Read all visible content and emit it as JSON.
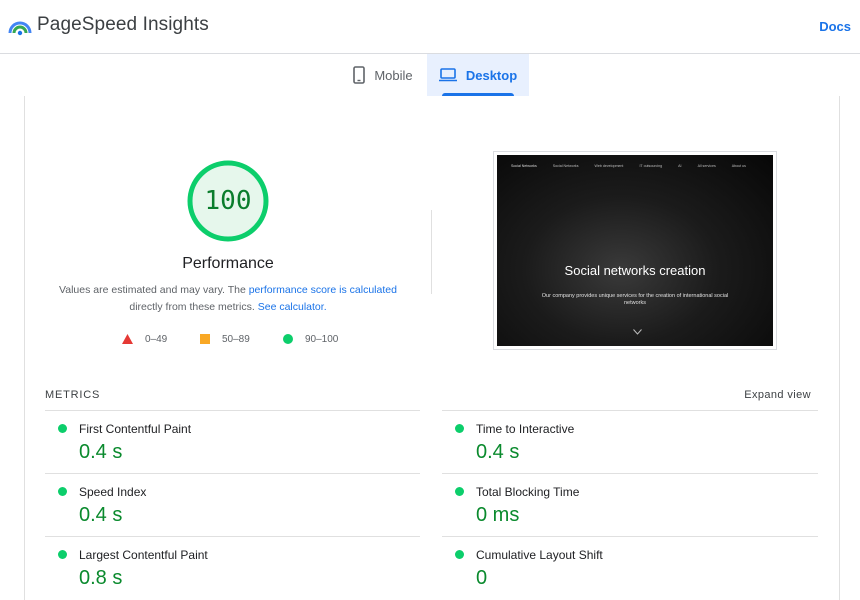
{
  "header": {
    "title": "PageSpeed Insights",
    "docs_label": "Docs"
  },
  "tabs": [
    {
      "label": "Mobile",
      "icon": "smartphone-icon",
      "active": false
    },
    {
      "label": "Desktop",
      "icon": "laptop-icon",
      "active": true
    }
  ],
  "performance": {
    "score": "100",
    "score_fraction": 1.0,
    "title": "Performance",
    "desc_prefix": "Values are estimated and may vary. The ",
    "desc_link1": "performance score is calculated",
    "desc_middle": "directly from these metrics. ",
    "desc_link2": "See calculator."
  },
  "legend": [
    {
      "shape": "triangle",
      "range": "0–49",
      "color": "#e53935"
    },
    {
      "shape": "square",
      "range": "50–89",
      "color": "#f9a825"
    },
    {
      "shape": "circle",
      "range": "90–100",
      "color": "#0cce6b"
    }
  ],
  "screenshot": {
    "nav_brand": "Social Networks",
    "nav_items": [
      "Social Networks",
      "Web development",
      "IT outsourcing",
      "AI",
      "All services",
      "About us"
    ],
    "headline": "Social networks creation",
    "subtext": "Our company provides unique services for the creation of international social networks"
  },
  "metrics_section": {
    "label": "METRICS",
    "expand_label": "Expand view"
  },
  "metrics": [
    {
      "name": "First Contentful Paint",
      "value": "0.4 s"
    },
    {
      "name": "Time to Interactive",
      "value": "0.4 s"
    },
    {
      "name": "Speed Index",
      "value": "0.4 s"
    },
    {
      "name": "Total Blocking Time",
      "value": "0 ms"
    },
    {
      "name": "Largest Contentful Paint",
      "value": "0.8 s"
    },
    {
      "name": "Cumulative Layout Shift",
      "value": "0"
    }
  ],
  "colors": {
    "accent": "#1a73e8",
    "pass": "#0cce6b",
    "pass_text": "#0a8a2d"
  }
}
